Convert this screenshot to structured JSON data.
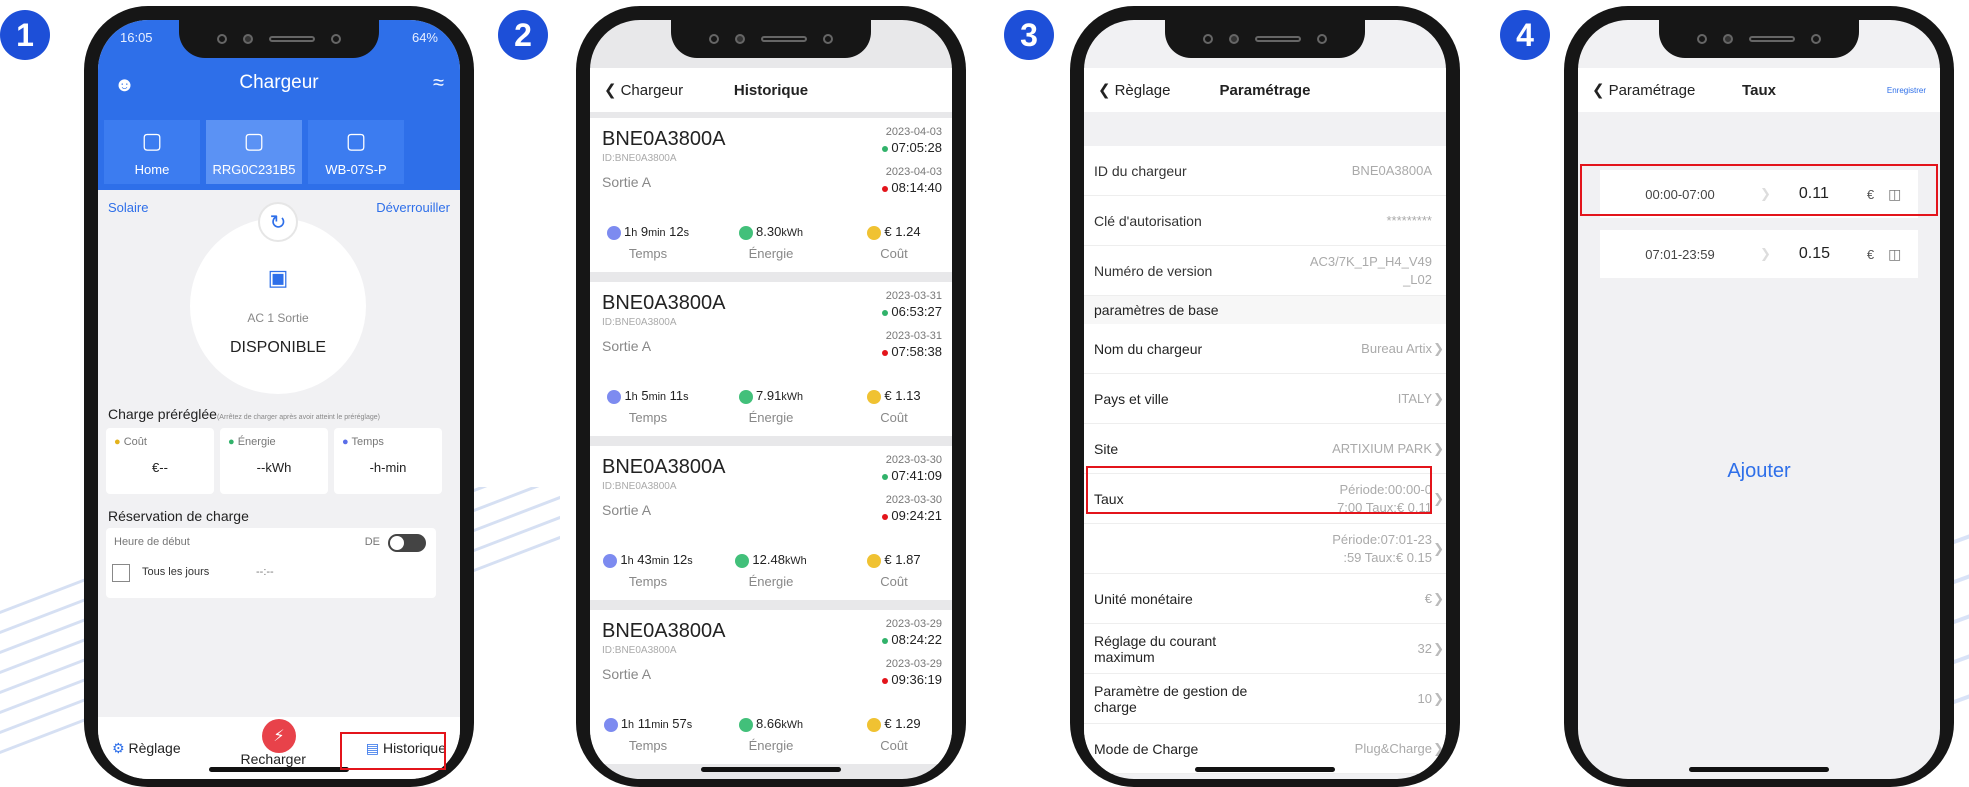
{
  "steps": [
    "1",
    "2",
    "3",
    "4"
  ],
  "phone1": {
    "status_time": "16:05",
    "status_battery": "64%",
    "title": "Chargeur",
    "tabs": [
      "Home",
      "RRG0C231B5",
      "WB-07S-P"
    ],
    "solar": "Solaire",
    "unlock": "Déverrouiller",
    "conn": "AC 1 Sortie",
    "state": "DISPONIBLE",
    "preset_title": "Charge préréglée",
    "preset_note": "(Arrêtez de charger après avoir atteint le préréglage)",
    "cards": [
      {
        "label": "Coût",
        "value": "€--"
      },
      {
        "label": "Énergie",
        "value": "--kWh"
      },
      {
        "label": "Temps",
        "value": "-h-min"
      }
    ],
    "resv_title": "Réservation de charge",
    "start": "Heure de début",
    "de": "DE",
    "daily": "Tous les jours",
    "time_val": "--:--",
    "nav_settings": "Règlage",
    "nav_charge": "Recharger",
    "nav_history": "Historique"
  },
  "phone2": {
    "back": "Chargeur",
    "title": "Historique",
    "stat_labels": [
      "Temps",
      "Énergie",
      "Coût"
    ],
    "records": [
      {
        "id": "BNE0A3800A",
        "sid": "ID:BNE0A3800A",
        "sortie": "Sortie A",
        "d1": "2023-04-03",
        "t1": "07:05:28",
        "d2": "2023-04-03",
        "t2": "08:14:40",
        "h": "1",
        "m": "9",
        "s": "12",
        "kwh": "8.30",
        "cost": "€ 1.24"
      },
      {
        "id": "BNE0A3800A",
        "sid": "ID:BNE0A3800A",
        "sortie": "Sortie A",
        "d1": "2023-03-31",
        "t1": "06:53:27",
        "d2": "2023-03-31",
        "t2": "07:58:38",
        "h": "1",
        "m": "5",
        "s": "11",
        "kwh": "7.91",
        "cost": "€ 1.13"
      },
      {
        "id": "BNE0A3800A",
        "sid": "ID:BNE0A3800A",
        "sortie": "Sortie A",
        "d1": "2023-03-30",
        "t1": "07:41:09",
        "d2": "2023-03-30",
        "t2": "09:24:21",
        "h": "1",
        "m": "43",
        "s": "12",
        "kwh": "12.48",
        "cost": "€ 1.87"
      },
      {
        "id": "BNE0A3800A",
        "sid": "ID:BNE0A3800A",
        "sortie": "Sortie A",
        "d1": "2023-03-29",
        "t1": "08:24:22",
        "d2": "2023-03-29",
        "t2": "09:36:19",
        "h": "1",
        "m": "11",
        "s": "57",
        "kwh": "8.66",
        "cost": "€ 1.29"
      }
    ],
    "unit_h": "h",
    "unit_min": "min",
    "unit_s": "s",
    "unit_kwh": "kWh"
  },
  "phone3": {
    "back": "Règlage",
    "title": "Paramétrage",
    "rows": [
      {
        "label": "ID du chargeur",
        "value": "BNE0A3800A"
      },
      {
        "label": "Clé d'autorisation",
        "value": "*********"
      },
      {
        "label": "Numéro de version",
        "value": "AC3/7K_1P_H4_V49 _L02"
      }
    ],
    "group": "paramètres de base",
    "rows2": [
      {
        "label": "Nom du chargeur",
        "value": "Bureau Artix"
      },
      {
        "label": "Pays et ville",
        "value": "ITALY"
      },
      {
        "label": "Site",
        "value": "ARTIXIUM PARK"
      },
      {
        "label": "Taux",
        "value": "Période:00:00-0 7:00 Taux:€ 0.11"
      },
      {
        "label": "",
        "value": "Période:07:01-23 :59 Taux:€ 0.15"
      },
      {
        "label": "Unité monétaire",
        "value": "€"
      },
      {
        "label": "Réglage du courant maximum",
        "value": "32"
      },
      {
        "label": "Paramètre de gestion de charge",
        "value": "10"
      },
      {
        "label": "Mode de Charge",
        "value": "Plug&Charge"
      }
    ]
  },
  "phone4": {
    "back": "Paramétrage",
    "title": "Taux",
    "save": "Enregistrer",
    "rates": [
      {
        "time": "00:00-07:00",
        "value": "0.11",
        "cur": "€"
      },
      {
        "time": "07:01-23:59",
        "value": "0.15",
        "cur": "€"
      }
    ],
    "add": "Ajouter"
  }
}
